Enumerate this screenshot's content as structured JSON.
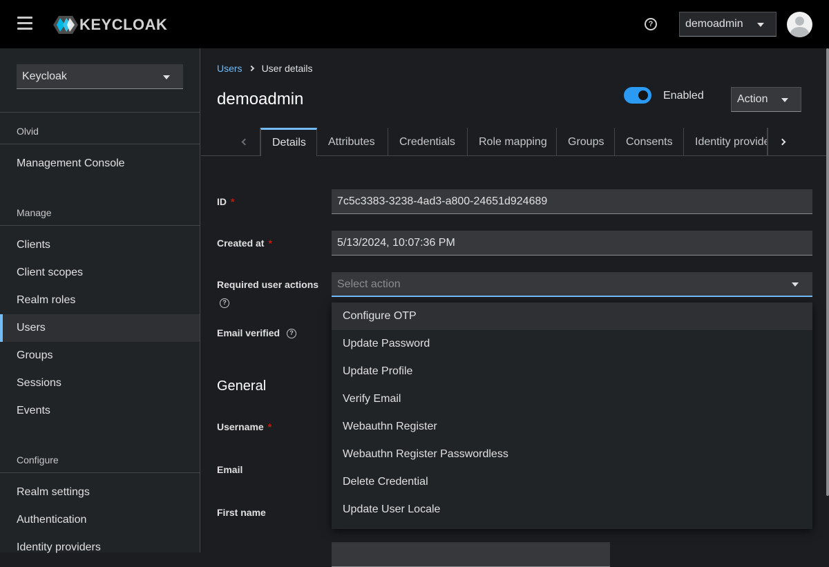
{
  "header": {
    "logo_text": "KEYCLOAK",
    "user_name": "demoadmin",
    "help_glyph": "?"
  },
  "sidebar": {
    "realm": "Keycloak",
    "realm_group": "Olvid",
    "console_link": "Management Console",
    "manage_heading": "Manage",
    "manage_items": [
      "Clients",
      "Client scopes",
      "Realm roles",
      "Users",
      "Groups",
      "Sessions",
      "Events"
    ],
    "active_item": "Users",
    "configure_heading": "Configure",
    "configure_items": [
      "Realm settings",
      "Authentication",
      "Identity providers"
    ]
  },
  "breadcrumb": {
    "parent": "Users",
    "current": "User details"
  },
  "page": {
    "title": "demoadmin",
    "enabled_label": "Enabled",
    "enabled": true,
    "action_label": "Action"
  },
  "tabs": [
    "Details",
    "Attributes",
    "Credentials",
    "Role mapping",
    "Groups",
    "Consents",
    "Identity provide"
  ],
  "active_tab": "Details",
  "form": {
    "id_label": "ID",
    "id_value": "7c5c3383-3238-4ad3-a800-24651d924689",
    "created_label": "Created at",
    "created_value": "5/13/2024, 10:07:36 PM",
    "required_actions_label": "Required user actions",
    "required_actions_placeholder": "Select action",
    "email_verified_label": "Email verified",
    "general_heading": "General",
    "username_label": "Username",
    "email_label": "Email",
    "first_name_label": "First name",
    "required_marker": "*"
  },
  "required_actions_menu": [
    "Configure OTP",
    "Update Password",
    "Update Profile",
    "Verify Email",
    "Webauthn Register",
    "Webauthn Register Passwordless",
    "Delete Credential",
    "Update User Locale"
  ],
  "colors": {
    "accent": "#73bcf7",
    "toggle_on": "#2b9af3",
    "required": "#c9190b"
  }
}
